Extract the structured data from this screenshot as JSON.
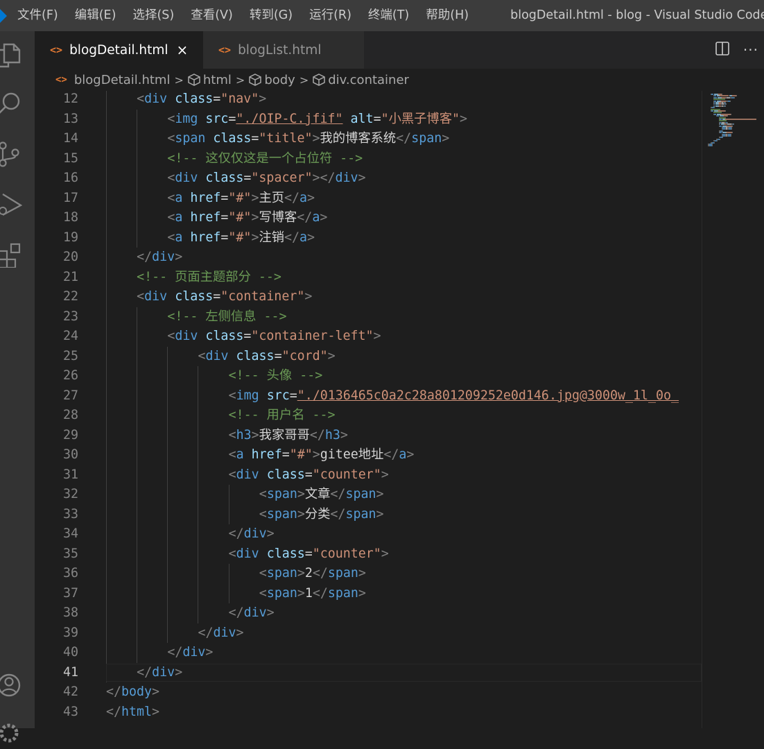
{
  "menu": [
    "文件(F)",
    "编辑(E)",
    "选择(S)",
    "查看(V)",
    "转到(G)",
    "运行(R)",
    "终端(T)",
    "帮助(H)"
  ],
  "window_title": "blogDetail.html - blog - Visual Studio Code",
  "tabs": [
    {
      "label": "blogDetail.html",
      "active": true,
      "icon": "<>"
    },
    {
      "label": "blogList.html",
      "active": false,
      "icon": "<>"
    }
  ],
  "tab_close": "×",
  "tab_more": "···",
  "breadcrumb": {
    "file_icon": "<>",
    "file": "blogDetail.html",
    "sep": ">",
    "items": [
      "html",
      "body",
      "div.container"
    ]
  },
  "current_line": 41,
  "lines": [
    {
      "n": "12",
      "indent": 1,
      "tokens": [
        [
          "br",
          "<"
        ],
        [
          "tag",
          "div"
        ],
        [
          "sp",
          " "
        ],
        [
          "attr",
          "class"
        ],
        [
          "eq",
          "="
        ],
        [
          "str",
          "\"nav\""
        ],
        [
          "br",
          ">"
        ]
      ]
    },
    {
      "n": "13",
      "indent": 2,
      "tokens": [
        [
          "br",
          "<"
        ],
        [
          "tag",
          "img"
        ],
        [
          "sp",
          " "
        ],
        [
          "attr",
          "src"
        ],
        [
          "eq",
          "="
        ],
        [
          "stru",
          "\"./OIP-C.jfif\""
        ],
        [
          "sp",
          " "
        ],
        [
          "attr",
          "alt"
        ],
        [
          "eq",
          "="
        ],
        [
          "str",
          "\"小黑子博客\""
        ],
        [
          "br",
          ">"
        ]
      ]
    },
    {
      "n": "14",
      "indent": 2,
      "tokens": [
        [
          "br",
          "<"
        ],
        [
          "tag",
          "span"
        ],
        [
          "sp",
          " "
        ],
        [
          "attr",
          "class"
        ],
        [
          "eq",
          "="
        ],
        [
          "str",
          "\"title\""
        ],
        [
          "br",
          ">"
        ],
        [
          "txt",
          "我的博客系统"
        ],
        [
          "br",
          "</"
        ],
        [
          "tag",
          "span"
        ],
        [
          "br",
          ">"
        ]
      ]
    },
    {
      "n": "15",
      "indent": 2,
      "tokens": [
        [
          "com",
          "<!-- 这仅仅这是一个占位符 -->"
        ]
      ]
    },
    {
      "n": "16",
      "indent": 2,
      "tokens": [
        [
          "br",
          "<"
        ],
        [
          "tag",
          "div"
        ],
        [
          "sp",
          " "
        ],
        [
          "attr",
          "class"
        ],
        [
          "eq",
          "="
        ],
        [
          "str",
          "\"spacer\""
        ],
        [
          "br",
          "></"
        ],
        [
          "tag",
          "div"
        ],
        [
          "br",
          ">"
        ]
      ]
    },
    {
      "n": "17",
      "indent": 2,
      "tokens": [
        [
          "br",
          "<"
        ],
        [
          "tag",
          "a"
        ],
        [
          "sp",
          " "
        ],
        [
          "attr",
          "href"
        ],
        [
          "eq",
          "="
        ],
        [
          "str",
          "\"#\""
        ],
        [
          "br",
          ">"
        ],
        [
          "txt",
          "主页"
        ],
        [
          "br",
          "</"
        ],
        [
          "tag",
          "a"
        ],
        [
          "br",
          ">"
        ]
      ]
    },
    {
      "n": "18",
      "indent": 2,
      "tokens": [
        [
          "br",
          "<"
        ],
        [
          "tag",
          "a"
        ],
        [
          "sp",
          " "
        ],
        [
          "attr",
          "href"
        ],
        [
          "eq",
          "="
        ],
        [
          "str",
          "\"#\""
        ],
        [
          "br",
          ">"
        ],
        [
          "txt",
          "写博客"
        ],
        [
          "br",
          "</"
        ],
        [
          "tag",
          "a"
        ],
        [
          "br",
          ">"
        ]
      ]
    },
    {
      "n": "19",
      "indent": 2,
      "tokens": [
        [
          "br",
          "<"
        ],
        [
          "tag",
          "a"
        ],
        [
          "sp",
          " "
        ],
        [
          "attr",
          "href"
        ],
        [
          "eq",
          "="
        ],
        [
          "str",
          "\"#\""
        ],
        [
          "br",
          ">"
        ],
        [
          "txt",
          "注销"
        ],
        [
          "br",
          "</"
        ],
        [
          "tag",
          "a"
        ],
        [
          "br",
          ">"
        ]
      ]
    },
    {
      "n": "20",
      "indent": 1,
      "tokens": [
        [
          "br",
          "</"
        ],
        [
          "tag",
          "div"
        ],
        [
          "br",
          ">"
        ]
      ]
    },
    {
      "n": "21",
      "indent": 1,
      "tokens": [
        [
          "com",
          "<!-- 页面主题部分 -->"
        ]
      ]
    },
    {
      "n": "22",
      "indent": 1,
      "tokens": [
        [
          "br",
          "<"
        ],
        [
          "tag",
          "div"
        ],
        [
          "sp",
          " "
        ],
        [
          "attr",
          "class"
        ],
        [
          "eq",
          "="
        ],
        [
          "str",
          "\"container\""
        ],
        [
          "br",
          ">"
        ]
      ]
    },
    {
      "n": "23",
      "indent": 2,
      "tokens": [
        [
          "com",
          "<!-- 左侧信息 -->"
        ]
      ]
    },
    {
      "n": "24",
      "indent": 2,
      "tokens": [
        [
          "br",
          "<"
        ],
        [
          "tag",
          "div"
        ],
        [
          "sp",
          " "
        ],
        [
          "attr",
          "class"
        ],
        [
          "eq",
          "="
        ],
        [
          "str",
          "\"container-left\""
        ],
        [
          "br",
          ">"
        ]
      ]
    },
    {
      "n": "25",
      "indent": 3,
      "tokens": [
        [
          "br",
          "<"
        ],
        [
          "tag",
          "div"
        ],
        [
          "sp",
          " "
        ],
        [
          "attr",
          "class"
        ],
        [
          "eq",
          "="
        ],
        [
          "str",
          "\"cord\""
        ],
        [
          "br",
          ">"
        ]
      ]
    },
    {
      "n": "26",
      "indent": 4,
      "tokens": [
        [
          "com",
          "<!-- 头像 -->"
        ]
      ]
    },
    {
      "n": "27",
      "indent": 4,
      "tokens": [
        [
          "br",
          "<"
        ],
        [
          "tag",
          "img"
        ],
        [
          "sp",
          " "
        ],
        [
          "attr",
          "src"
        ],
        [
          "eq",
          "="
        ],
        [
          "stru",
          "\"./0136465c0a2c28a801209252e0d146.jpg@3000w_1l_0o_"
        ]
      ]
    },
    {
      "n": "28",
      "indent": 4,
      "tokens": [
        [
          "com",
          "<!-- 用户名 -->"
        ]
      ]
    },
    {
      "n": "29",
      "indent": 4,
      "tokens": [
        [
          "br",
          "<"
        ],
        [
          "tag",
          "h3"
        ],
        [
          "br",
          ">"
        ],
        [
          "txt",
          "我家哥哥"
        ],
        [
          "br",
          "</"
        ],
        [
          "tag",
          "h3"
        ],
        [
          "br",
          ">"
        ]
      ]
    },
    {
      "n": "30",
      "indent": 4,
      "tokens": [
        [
          "br",
          "<"
        ],
        [
          "tag",
          "a"
        ],
        [
          "sp",
          " "
        ],
        [
          "attr",
          "href"
        ],
        [
          "eq",
          "="
        ],
        [
          "str",
          "\"#\""
        ],
        [
          "br",
          ">"
        ],
        [
          "txt",
          "gitee地址"
        ],
        [
          "br",
          "</"
        ],
        [
          "tag",
          "a"
        ],
        [
          "br",
          ">"
        ]
      ]
    },
    {
      "n": "31",
      "indent": 4,
      "tokens": [
        [
          "br",
          "<"
        ],
        [
          "tag",
          "div"
        ],
        [
          "sp",
          " "
        ],
        [
          "attr",
          "class"
        ],
        [
          "eq",
          "="
        ],
        [
          "str",
          "\"counter\""
        ],
        [
          "br",
          ">"
        ]
      ]
    },
    {
      "n": "32",
      "indent": 5,
      "tokens": [
        [
          "br",
          "<"
        ],
        [
          "tag",
          "span"
        ],
        [
          "br",
          ">"
        ],
        [
          "txt",
          "文章"
        ],
        [
          "br",
          "</"
        ],
        [
          "tag",
          "span"
        ],
        [
          "br",
          ">"
        ]
      ]
    },
    {
      "n": "33",
      "indent": 5,
      "tokens": [
        [
          "br",
          "<"
        ],
        [
          "tag",
          "span"
        ],
        [
          "br",
          ">"
        ],
        [
          "txt",
          "分类"
        ],
        [
          "br",
          "</"
        ],
        [
          "tag",
          "span"
        ],
        [
          "br",
          ">"
        ]
      ]
    },
    {
      "n": "34",
      "indent": 4,
      "tokens": [
        [
          "br",
          "</"
        ],
        [
          "tag",
          "div"
        ],
        [
          "br",
          ">"
        ]
      ]
    },
    {
      "n": "35",
      "indent": 4,
      "tokens": [
        [
          "br",
          "<"
        ],
        [
          "tag",
          "div"
        ],
        [
          "sp",
          " "
        ],
        [
          "attr",
          "class"
        ],
        [
          "eq",
          "="
        ],
        [
          "str",
          "\"counter\""
        ],
        [
          "br",
          ">"
        ]
      ]
    },
    {
      "n": "36",
      "indent": 5,
      "tokens": [
        [
          "br",
          "<"
        ],
        [
          "tag",
          "span"
        ],
        [
          "br",
          ">"
        ],
        [
          "txt",
          "2"
        ],
        [
          "br",
          "</"
        ],
        [
          "tag",
          "span"
        ],
        [
          "br",
          ">"
        ]
      ]
    },
    {
      "n": "37",
      "indent": 5,
      "tokens": [
        [
          "br",
          "<"
        ],
        [
          "tag",
          "span"
        ],
        [
          "br",
          ">"
        ],
        [
          "txt",
          "1"
        ],
        [
          "br",
          "</"
        ],
        [
          "tag",
          "span"
        ],
        [
          "br",
          ">"
        ]
      ]
    },
    {
      "n": "38",
      "indent": 4,
      "tokens": [
        [
          "br",
          "</"
        ],
        [
          "tag",
          "div"
        ],
        [
          "br",
          ">"
        ]
      ]
    },
    {
      "n": "39",
      "indent": 3,
      "tokens": [
        [
          "br",
          "</"
        ],
        [
          "tag",
          "div"
        ],
        [
          "br",
          ">"
        ]
      ]
    },
    {
      "n": "40",
      "indent": 2,
      "tokens": [
        [
          "br",
          "</"
        ],
        [
          "tag",
          "div"
        ],
        [
          "br",
          ">"
        ]
      ]
    },
    {
      "n": "41",
      "indent": 1,
      "tokens": [
        [
          "br",
          "</"
        ],
        [
          "tag",
          "div"
        ],
        [
          "br",
          ">"
        ]
      ]
    },
    {
      "n": "42",
      "indent": 0,
      "tokens": [
        [
          "br",
          "</"
        ],
        [
          "tag",
          "body"
        ],
        [
          "br",
          ">"
        ]
      ]
    },
    {
      "n": "43",
      "indent": 0,
      "tokens": [
        [
          "br",
          "</"
        ],
        [
          "tag",
          "html"
        ],
        [
          "br",
          ">"
        ]
      ]
    }
  ],
  "activity_icons": [
    "explorer-icon",
    "search-icon",
    "source-control-icon",
    "run-debug-icon",
    "extensions-icon",
    "account-icon",
    "settings-gear-icon"
  ],
  "colors": {
    "tag": "#569cd6",
    "attr": "#9cdcfe",
    "string": "#ce9178",
    "comment": "#6a9955",
    "text": "#d4d4d4",
    "bracket": "#808080",
    "vscode_blue": "#0078d4"
  }
}
